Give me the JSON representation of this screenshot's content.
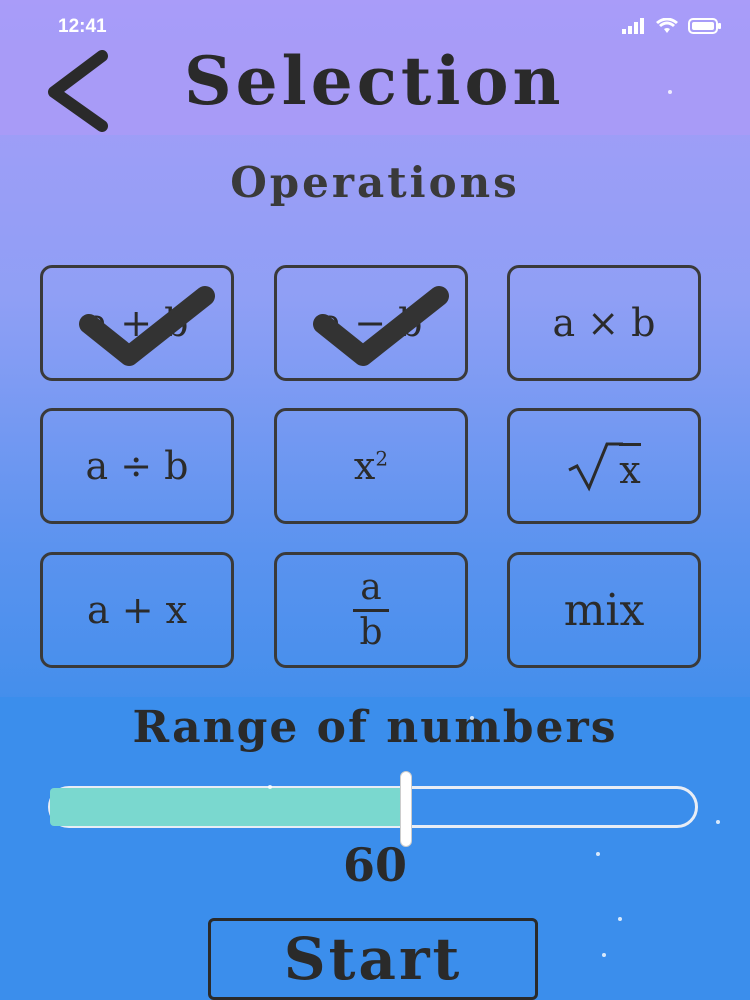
{
  "status": {
    "time": "12:41"
  },
  "header": {
    "title": "Selection"
  },
  "operations": {
    "label": "Operations",
    "items": [
      {
        "name": "addition",
        "label": "a + b",
        "checked": true
      },
      {
        "name": "subtraction",
        "label": "a − b",
        "checked": true
      },
      {
        "name": "multiplication",
        "label": "a × b",
        "checked": false
      },
      {
        "name": "division",
        "label": "a ÷ b",
        "checked": false
      },
      {
        "name": "square",
        "base": "x",
        "exponent": "2",
        "checked": false
      },
      {
        "name": "square-root",
        "radicand": "x",
        "checked": false
      },
      {
        "name": "unknown-addition",
        "label": "a + x",
        "checked": false
      },
      {
        "name": "fraction",
        "numerator": "a",
        "denominator": "b",
        "checked": false
      },
      {
        "name": "mix",
        "label": "mix",
        "checked": false
      }
    ]
  },
  "range": {
    "title": "Range of numbers",
    "value": "60",
    "fraction": 0.55
  },
  "start": {
    "label": "Start"
  },
  "colors": {
    "fill": "#7ad8cf",
    "header": "#a89bf7",
    "band": "#3b8eec"
  }
}
